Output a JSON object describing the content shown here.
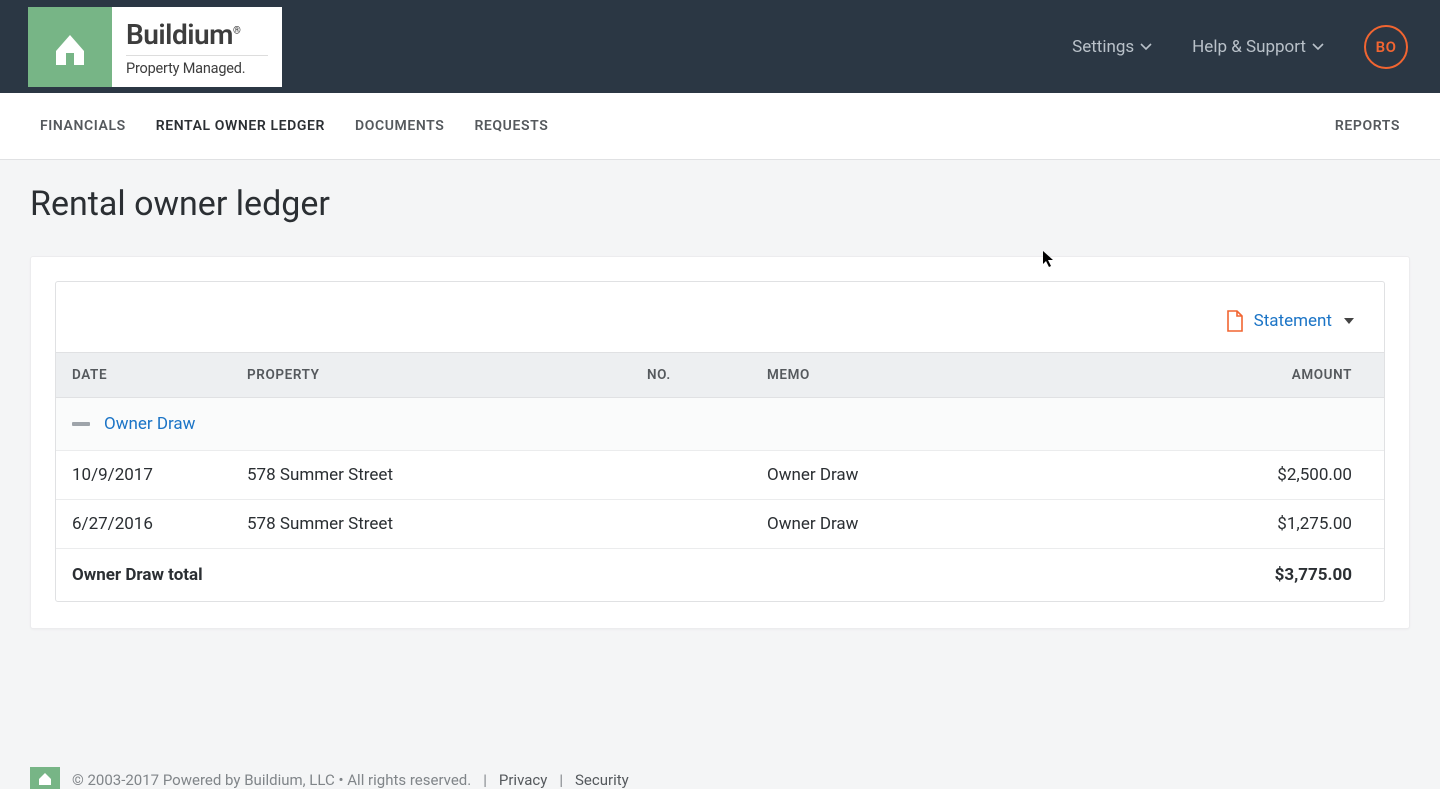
{
  "brand": {
    "name": "Buildium",
    "tagline": "Property Managed."
  },
  "topbar": {
    "settings": "Settings",
    "help": "Help & Support",
    "avatar_initials": "BO"
  },
  "nav": {
    "tabs": [
      {
        "label": "FINANCIALS"
      },
      {
        "label": "RENTAL OWNER LEDGER"
      },
      {
        "label": "DOCUMENTS"
      },
      {
        "label": "REQUESTS"
      }
    ],
    "reports": "REPORTS"
  },
  "page": {
    "title": "Rental owner ledger"
  },
  "panel": {
    "statement_label": "Statement"
  },
  "table": {
    "headers": {
      "date": "DATE",
      "property": "PROPERTY",
      "no": "NO.",
      "memo": "MEMO",
      "amount": "AMOUNT"
    },
    "group": {
      "label": "Owner Draw",
      "rows": [
        {
          "date": "10/9/2017",
          "property": "578 Summer Street",
          "no": "",
          "memo": "Owner Draw",
          "amount": "$2,500.00"
        },
        {
          "date": "6/27/2016",
          "property": "578 Summer Street",
          "no": "",
          "memo": "Owner Draw",
          "amount": "$1,275.00"
        }
      ],
      "total_label": "Owner Draw total",
      "total_amount": "$3,775.00"
    }
  },
  "footer": {
    "copyright": "© 2003-2017 Powered by Buildium, LLC • All rights reserved.",
    "privacy": "Privacy",
    "security": "Security"
  }
}
